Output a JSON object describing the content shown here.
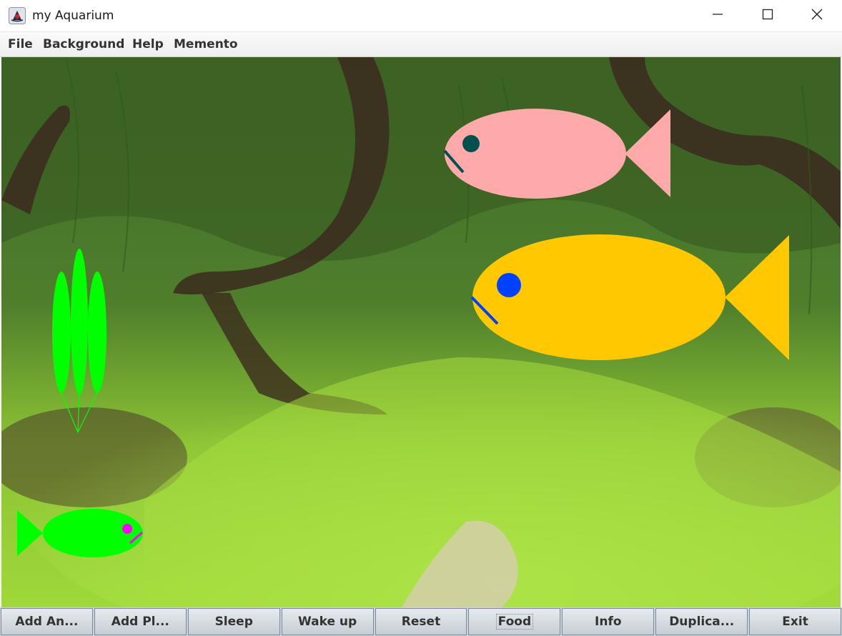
{
  "window": {
    "title": "my Aquarium",
    "app_icon": "java-duke-icon",
    "controls": [
      "minimize-icon",
      "maximize-icon",
      "close-icon"
    ]
  },
  "menu": {
    "file": "File",
    "background": "Background",
    "help": "Help",
    "memento": "Memento"
  },
  "aquarium": {
    "background": "planted-aquarium-photo",
    "fish": [
      {
        "body_color": "#FFAAAA",
        "eye_color": "#005050",
        "facing": "left"
      },
      {
        "body_color": "#FFC800",
        "eye_color": "#0040FF",
        "facing": "left"
      },
      {
        "body_color": "#00FF00",
        "eye_color": "#FF00FF",
        "facing": "right"
      }
    ],
    "plant": {
      "color": "#00FF00"
    }
  },
  "toolbar": {
    "add_animal": "Add An...",
    "add_plant": "Add Pl...",
    "sleep": "Sleep",
    "wake_up": "Wake up",
    "reset": "Reset",
    "food": "Food",
    "info": "Info",
    "duplicate": "Duplica...",
    "exit": "Exit"
  }
}
